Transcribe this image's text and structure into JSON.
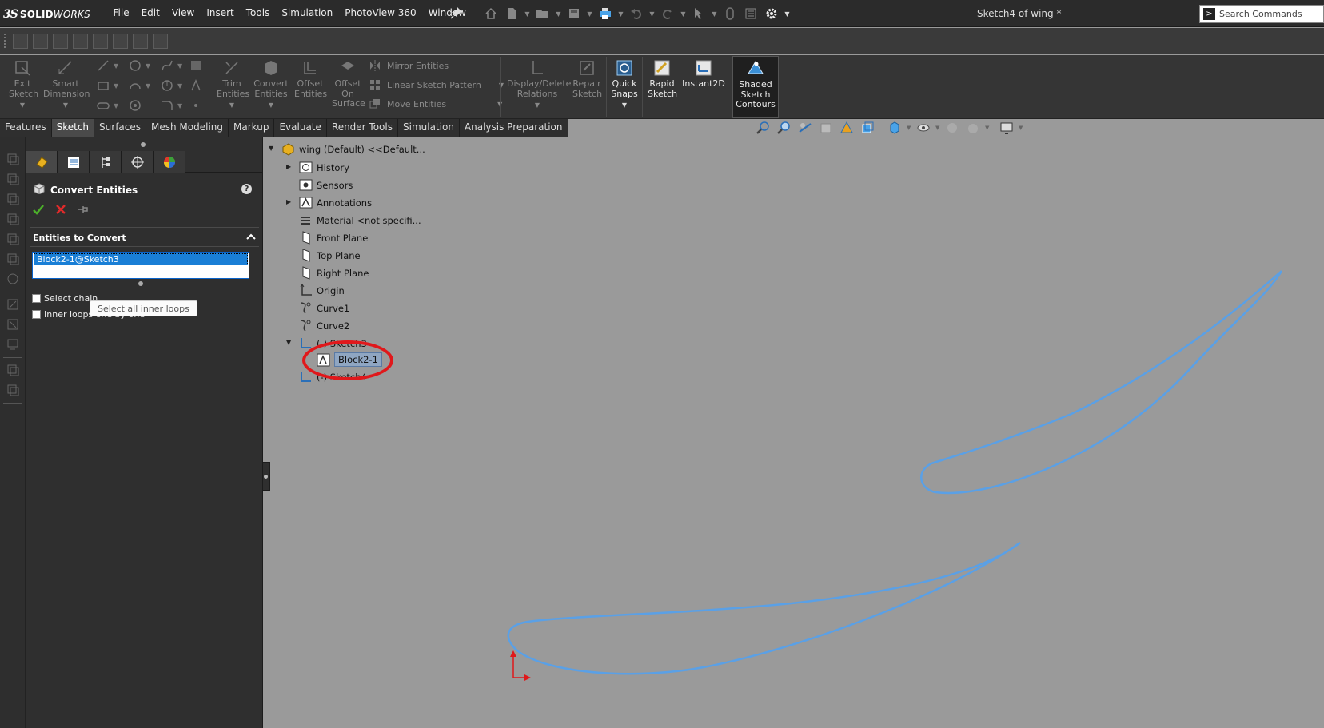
{
  "app": {
    "logo_mark": "3S",
    "logo_name_bold": "SOLID",
    "logo_name_italic": "WORKS",
    "document_title": "Sketch4 of wing *"
  },
  "menu": [
    "File",
    "Edit",
    "View",
    "Insert",
    "Tools",
    "Simulation",
    "PhotoView 360",
    "Window"
  ],
  "search": {
    "placeholder": "Search Commands"
  },
  "command_manager": {
    "exit_sketch": "Exit Sketch",
    "smart_dimension": "Smart Dimension",
    "trim_entities": "Trim Entities",
    "convert_entities": "Convert Entities",
    "offset_entities": "Offset Entities",
    "offset_on_surface": "Offset On Surface",
    "mirror_entities": "Mirror Entities",
    "linear_sketch_pattern": "Linear Sketch Pattern",
    "move_entities": "Move Entities",
    "display_delete_relations": "Display/Delete Relations",
    "repair_sketch": "Repair Sketch",
    "quick_snaps": "Quick Snaps",
    "rapid_sketch": "Rapid Sketch",
    "instant2d": "Instant2D",
    "shaded_sketch_contours": "Shaded Sketch Contours"
  },
  "tabs": [
    {
      "label": "Features",
      "active": false
    },
    {
      "label": "Sketch",
      "active": true
    },
    {
      "label": "Surfaces",
      "active": false
    },
    {
      "label": "Mesh Modeling",
      "active": false
    },
    {
      "label": "Markup",
      "active": false
    },
    {
      "label": "Evaluate",
      "active": false
    },
    {
      "label": "Render Tools",
      "active": false
    },
    {
      "label": "Simulation",
      "active": false
    },
    {
      "label": "Analysis Preparation",
      "active": false
    }
  ],
  "property_manager": {
    "title": "Convert Entities",
    "group_title": "Entities to Convert",
    "selected_entity": "Block2-1@Sketch3",
    "select_chain": "Select chain",
    "inner_loops": "Inner loops one by one",
    "select_all_inner_loops": "Select all inner loops"
  },
  "feature_tree": {
    "root": "wing (Default) <<Default...",
    "items": [
      "History",
      "Sensors",
      "Annotations",
      "Material <not specifi...",
      "Front Plane",
      "Top Plane",
      "Right Plane",
      "Origin",
      "Curve1",
      "Curve2"
    ],
    "sketch3": "(-) Sketch3",
    "block": "Block2-1",
    "sketch4": "(-) Sketch4"
  },
  "colors": {
    "accent": "#1a7fd6",
    "curve": "#5aa0e6",
    "highlight": "#e0181b",
    "viewport": "#9a9a9a"
  }
}
